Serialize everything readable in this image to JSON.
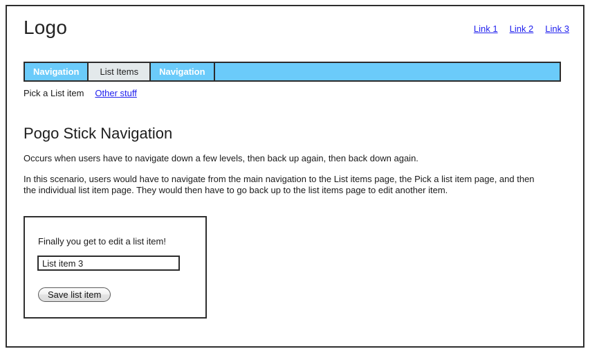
{
  "header": {
    "logo": "Logo",
    "links": [
      {
        "label": "Link 1"
      },
      {
        "label": "Link 2"
      },
      {
        "label": "Link 3"
      }
    ]
  },
  "nav": {
    "tabs": [
      {
        "label": "Navigation",
        "style": "blue",
        "active": true
      },
      {
        "label": "List Items",
        "style": "light",
        "active": false
      },
      {
        "label": "Navigation",
        "style": "blue-bordered",
        "active": false
      }
    ],
    "bar_color": "#6BCBFA",
    "tab_inactive_color": "#E3E9EB",
    "border_color": "#2b2b2b"
  },
  "breadcrumb": {
    "static_text": "Pick a List item",
    "link_text": "Other stuff"
  },
  "main": {
    "title": "Pogo Stick Navigation",
    "paragraph_1": "Occurs when users have to navigate down a few levels, then back up again, then back down again.",
    "paragraph_2": "In this scenario, users would have to navigate from the main navigation to the List items page, the Pick a list item page, and then the individual list item page. They would then have to go back up to the list items page to edit another item."
  },
  "edit_form": {
    "label": "Finally you get to edit a list item!",
    "input_value": "List item 3",
    "input_placeholder": "",
    "save_label": "Save list item"
  },
  "colors": {
    "link": "#2020ee",
    "accent_blue": "#6BCBFA",
    "frame_border": "#2e2e2e"
  }
}
